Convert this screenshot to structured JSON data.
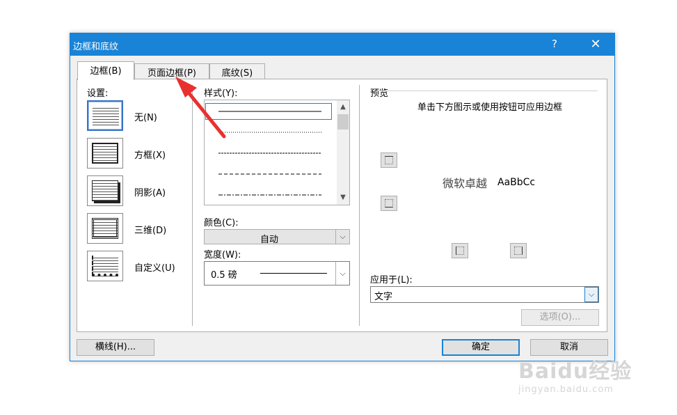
{
  "window": {
    "title": "边框和底纹",
    "help": "?",
    "close": "✕"
  },
  "tabs": [
    {
      "label": "边框(B)"
    },
    {
      "label": "页面边框(P)"
    },
    {
      "label": "底纹(S)"
    }
  ],
  "settings": {
    "heading": "设置:",
    "items": [
      {
        "label": "无(N)"
      },
      {
        "label": "方框(X)"
      },
      {
        "label": "阴影(A)"
      },
      {
        "label": "三维(D)"
      },
      {
        "label": "自定义(U)"
      }
    ]
  },
  "style": {
    "heading": "样式(Y):",
    "scroll_up": "▲",
    "scroll_down": "▼"
  },
  "color": {
    "heading": "颜色(C):",
    "value": "自动",
    "arrow": "⌵"
  },
  "width": {
    "heading": "宽度(W):",
    "value": "0.5 磅",
    "arrow": "⌵"
  },
  "preview": {
    "heading": "预览",
    "hint": "单击下方图示或使用按钮可应用边框",
    "sample_cn": "微软卓越",
    "sample_en": "AaBbCc"
  },
  "apply_to": {
    "heading": "应用于(L):",
    "value": "文字",
    "arrow": "⌵"
  },
  "buttons": {
    "options": "选项(O)...",
    "horizontal_line": "横线(H)...",
    "ok": "确定",
    "cancel": "取消"
  },
  "watermark": {
    "main": "Baidu经验",
    "sub": "jingyan.baidu.com"
  },
  "colors": {
    "titlebar": "#1883d7",
    "annotation_arrow": "#e8312f"
  }
}
